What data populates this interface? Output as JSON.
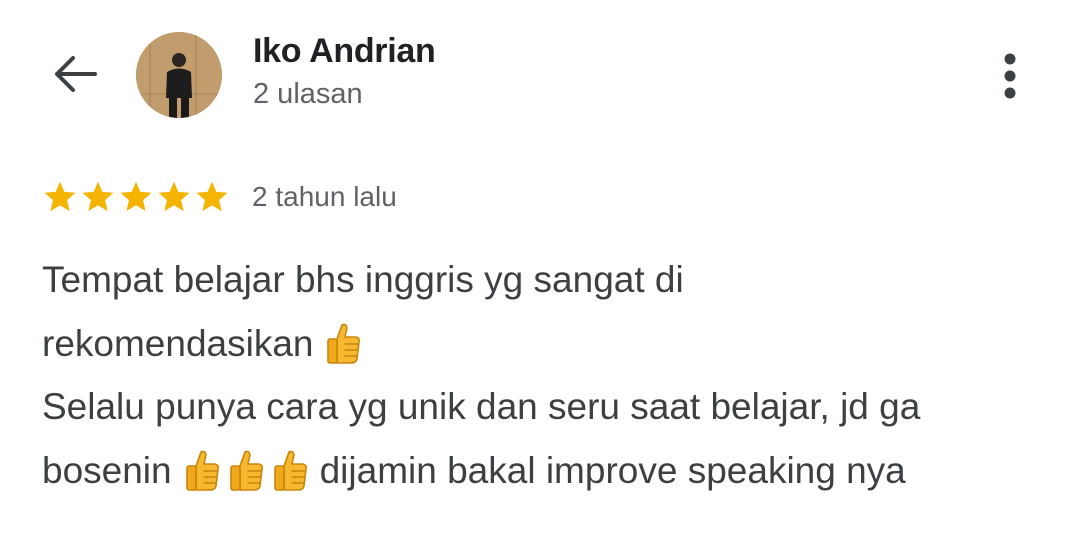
{
  "header": {
    "back_icon": "arrow-left-icon",
    "user_name": "Iko Andrian",
    "review_count": "2 ulasan",
    "more_icon": "more-vert-icon"
  },
  "review": {
    "rating": 5,
    "rating_max": 5,
    "star_color": "#f4b400",
    "date": "2 tahun lalu",
    "lines": [
      {
        "text_before": "Tempat belajar bhs inggris yg sangat di",
        "thumbs": 0,
        "text_after": ""
      },
      {
        "text_before": "rekomendasikan",
        "thumbs": 1,
        "text_after": ""
      },
      {
        "text_before": "Selalu punya cara yg unik dan seru saat belajar, jd ga",
        "thumbs": 0,
        "text_after": ""
      },
      {
        "text_before": "bosenin",
        "thumbs": 3,
        "text_after": "dijamin bakal improve speaking nya"
      }
    ],
    "emoji_icon": "thumbs-up-icon"
  }
}
